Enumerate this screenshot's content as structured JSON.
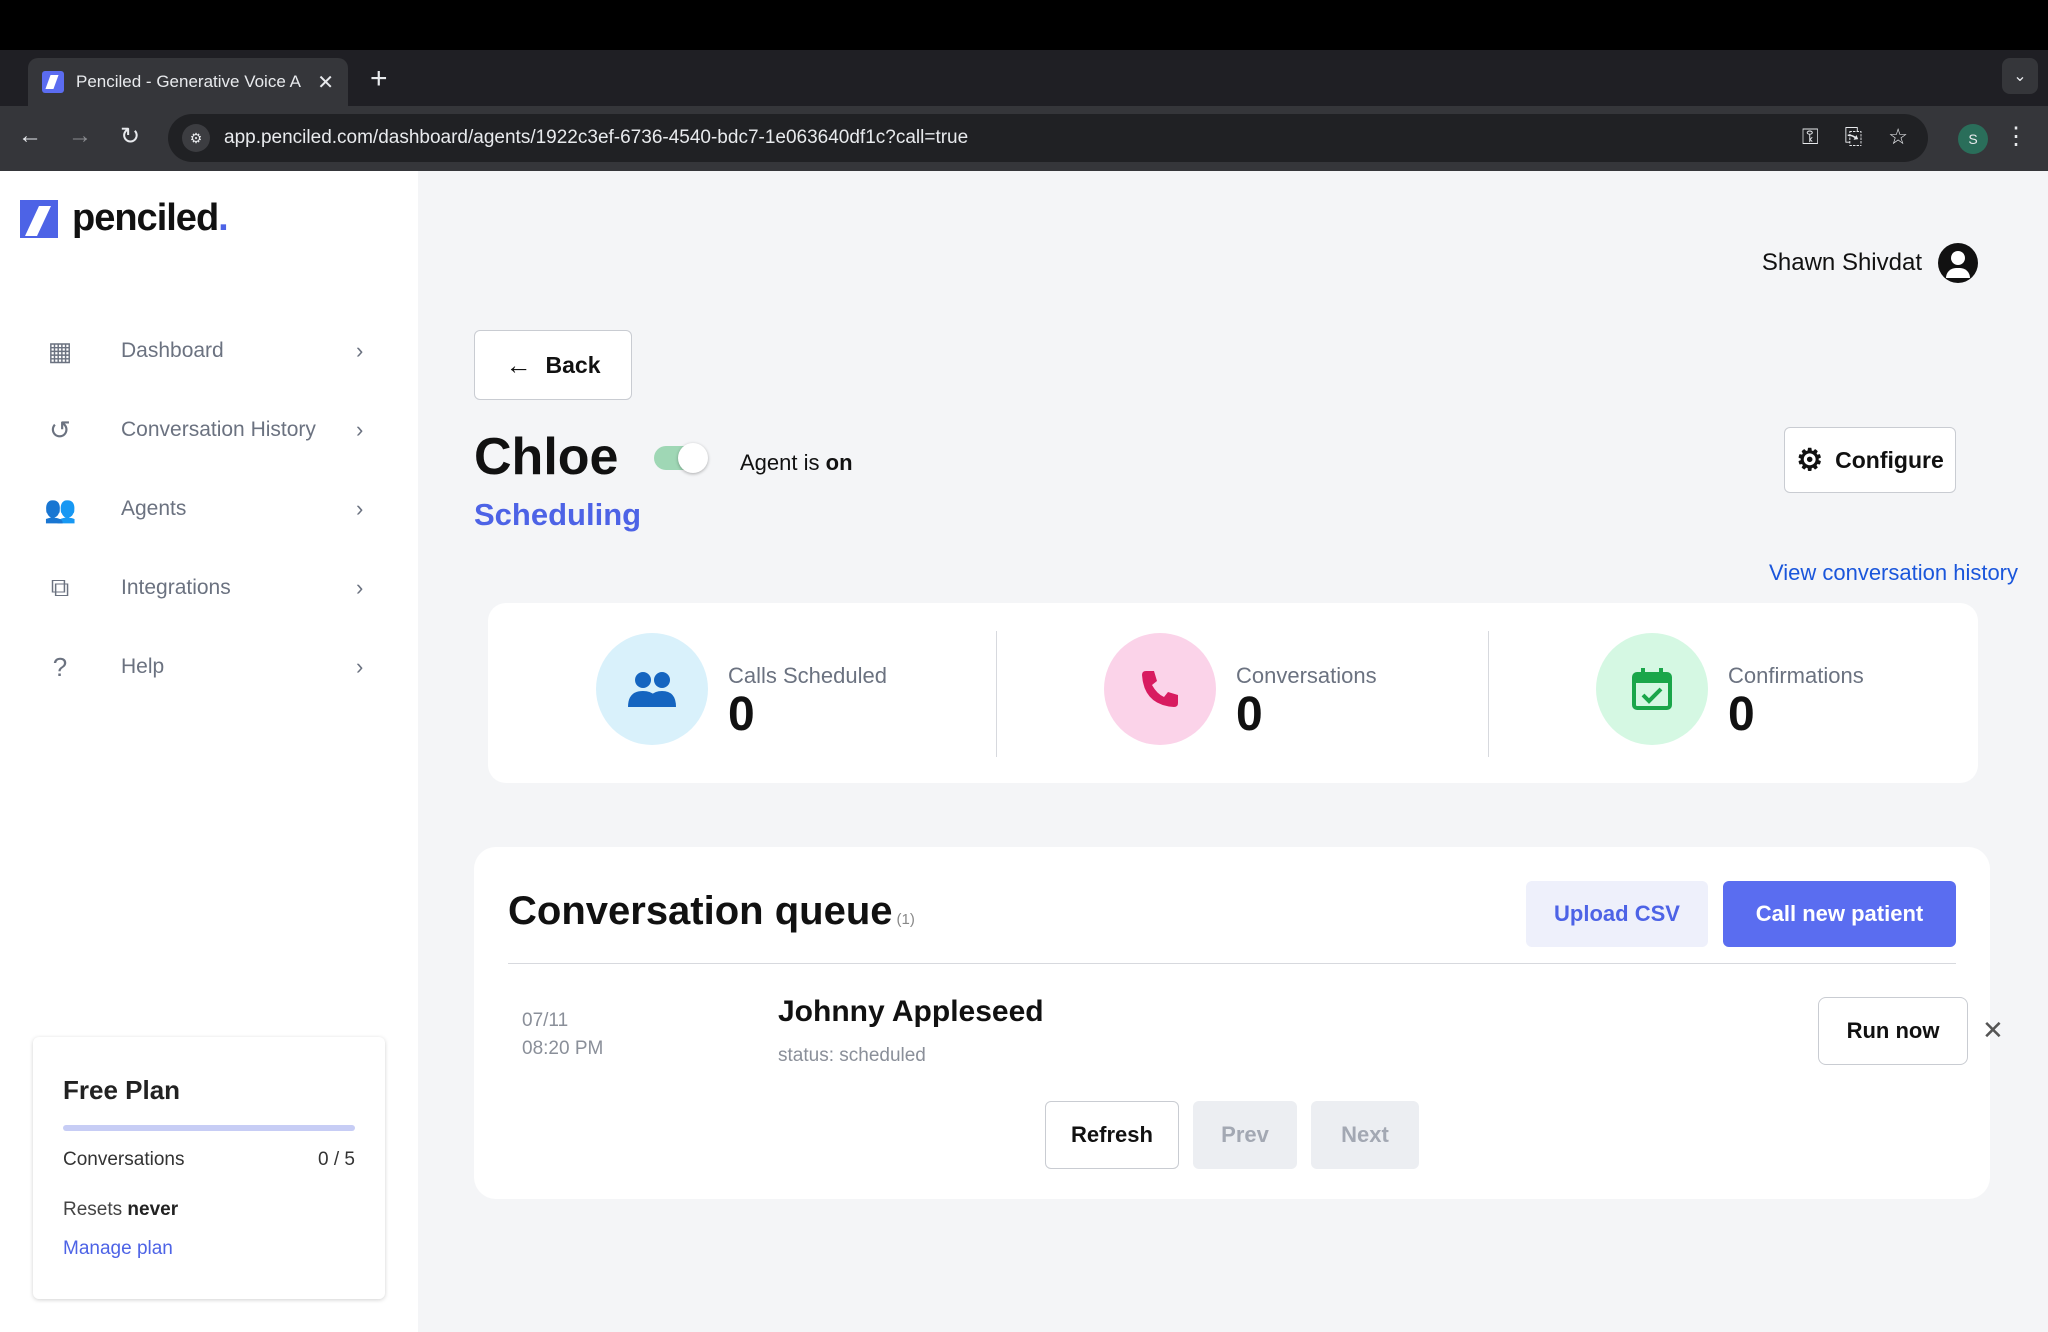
{
  "browser": {
    "tab_title": "Penciled - Generative Voice A",
    "tab_close": "✕",
    "new_tab": "+",
    "url": "app.penciled.com/dashboard/agents/1922c3ef-6736-4540-bdc7-1e063640df1c?call=true",
    "profile_initial": "S"
  },
  "sidebar": {
    "logo_text": "penciled",
    "logo_dot": ".",
    "items": [
      {
        "label": "Dashboard",
        "icon": "dashboard-icon"
      },
      {
        "label": "Conversation History",
        "icon": "history-icon"
      },
      {
        "label": "Agents",
        "icon": "people-icon"
      },
      {
        "label": "Integrations",
        "icon": "integrations-icon"
      },
      {
        "label": "Help",
        "icon": "help-icon"
      }
    ],
    "plan": {
      "title": "Free Plan",
      "conversations_label": "Conversations",
      "conversations_value": "0 / 5",
      "resets_prefix": "Resets",
      "resets_value": "never",
      "manage_label": "Manage plan"
    }
  },
  "header": {
    "user_name": "Shawn Shivdat"
  },
  "agent": {
    "back_label": "Back",
    "name": "Chloe",
    "status_prefix": "Agent is",
    "status_value": "on",
    "role": "Scheduling",
    "configure_label": "Configure",
    "view_history_label": "View conversation history"
  },
  "stats": [
    {
      "label": "Calls Scheduled",
      "value": "0",
      "icon": "people-icon",
      "color": "#d9f1fb",
      "icon_color": "#1565c0"
    },
    {
      "label": "Conversations",
      "value": "0",
      "icon": "phone-icon",
      "color": "#fbd3e9",
      "icon_color": "#d81b60"
    },
    {
      "label": "Confirmations",
      "value": "0",
      "icon": "calendar-check-icon",
      "color": "#d5f8e3",
      "icon_color": "#1aa64a"
    }
  ],
  "queue": {
    "title": "Conversation queue",
    "count": "(1)",
    "upload_label": "Upload CSV",
    "call_label": "Call new patient",
    "items": [
      {
        "date": "07/11",
        "time": "08:20 PM",
        "name": "Johnny Appleseed",
        "status": "status: scheduled",
        "run_label": "Run now"
      }
    ],
    "refresh_label": "Refresh",
    "prev_label": "Prev",
    "next_label": "Next"
  },
  "colors": {
    "brand": "#4d63e6",
    "link": "#1a56db"
  }
}
